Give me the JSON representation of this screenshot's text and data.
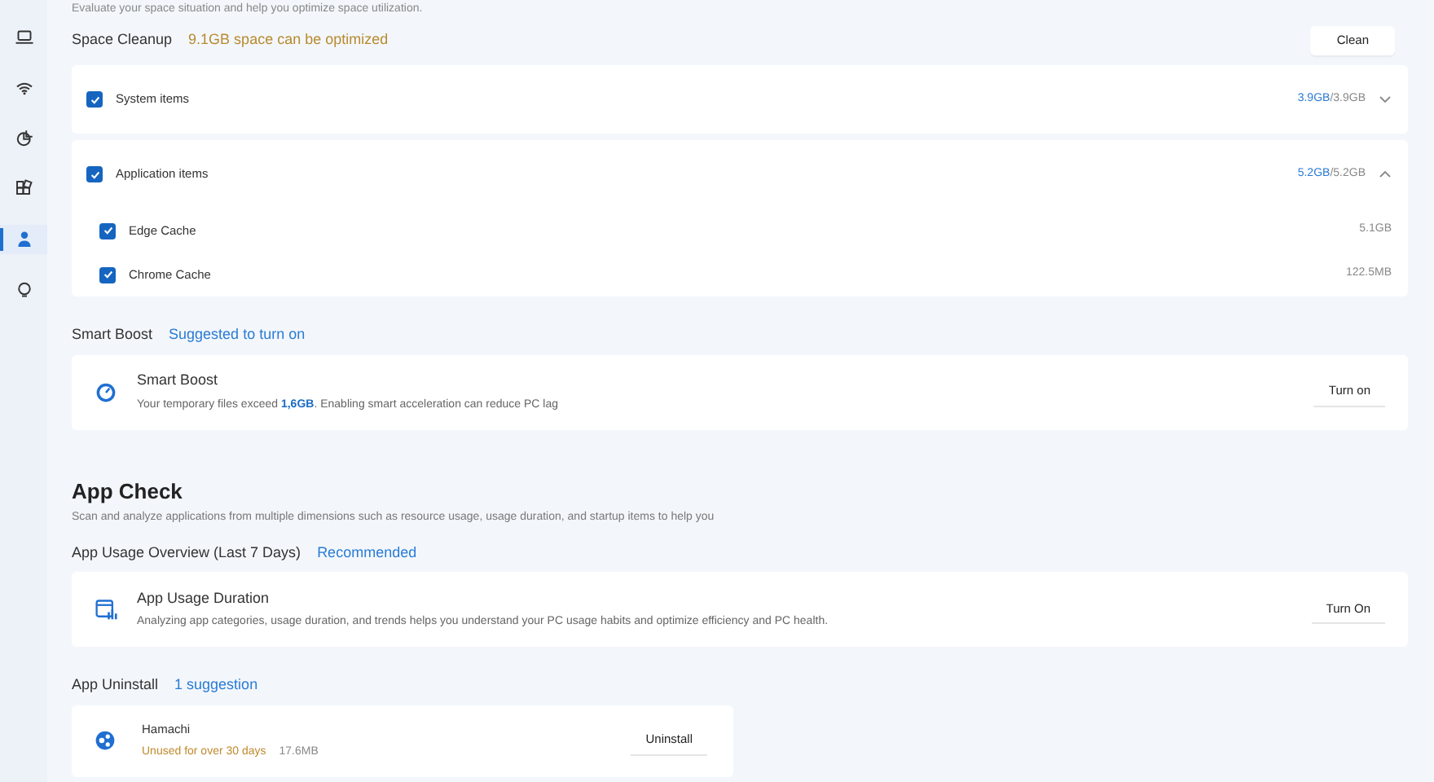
{
  "sidebar": {
    "items": [
      {
        "selected": false
      },
      {
        "selected": false
      },
      {
        "selected": false
      },
      {
        "selected": false
      },
      {
        "selected": true
      },
      {
        "selected": false
      }
    ]
  },
  "intro": "Evaluate your space situation and help you optimize space utilization.",
  "space_cleanup": {
    "title": "Space Cleanup",
    "summary": "9.1GB space can be optimized",
    "button": "Clean",
    "groups": [
      {
        "label": "System items",
        "checked": true,
        "expanded": false,
        "selected_size": "3.9GB",
        "total_size": "/3.9GB"
      },
      {
        "label": "Application items",
        "checked": true,
        "expanded": true,
        "selected_size": "5.2GB",
        "total_size": "/5.2GB",
        "children": [
          {
            "label": "Edge Cache",
            "checked": true,
            "size": "5.1GB"
          },
          {
            "label": "Chrome Cache",
            "checked": true,
            "size": "122.5MB"
          }
        ]
      }
    ]
  },
  "smart_boost": {
    "title": "Smart Boost",
    "tag": "Suggested to turn on",
    "card": {
      "title": "Smart Boost",
      "description": "Your temporary files exceed **1,6GB**. Enabling smart acceleration can reduce PC lag",
      "button": "Turn on"
    }
  },
  "app_check": {
    "title": "App Check",
    "description": "Scan and analyze applications from multiple dimensions such as resource usage, usage duration, and startup items to help you",
    "usage": {
      "title": "App Usage Overview (Last 7 Days)",
      "tag": "Recommended",
      "card": {
        "title": "App Usage Duration",
        "description": "Analyzing app categories, usage duration, and trends helps you understand your PC usage habits and optimize efficiency and PC health.",
        "button": "Turn On"
      }
    },
    "uninstall": {
      "title": "App Uninstall",
      "tag": "1 suggestion",
      "apps": [
        {
          "name": "Hamachi",
          "status": "Unused for over 30 days",
          "size": "17.6MB",
          "button": "Uninstall"
        }
      ]
    }
  }
}
